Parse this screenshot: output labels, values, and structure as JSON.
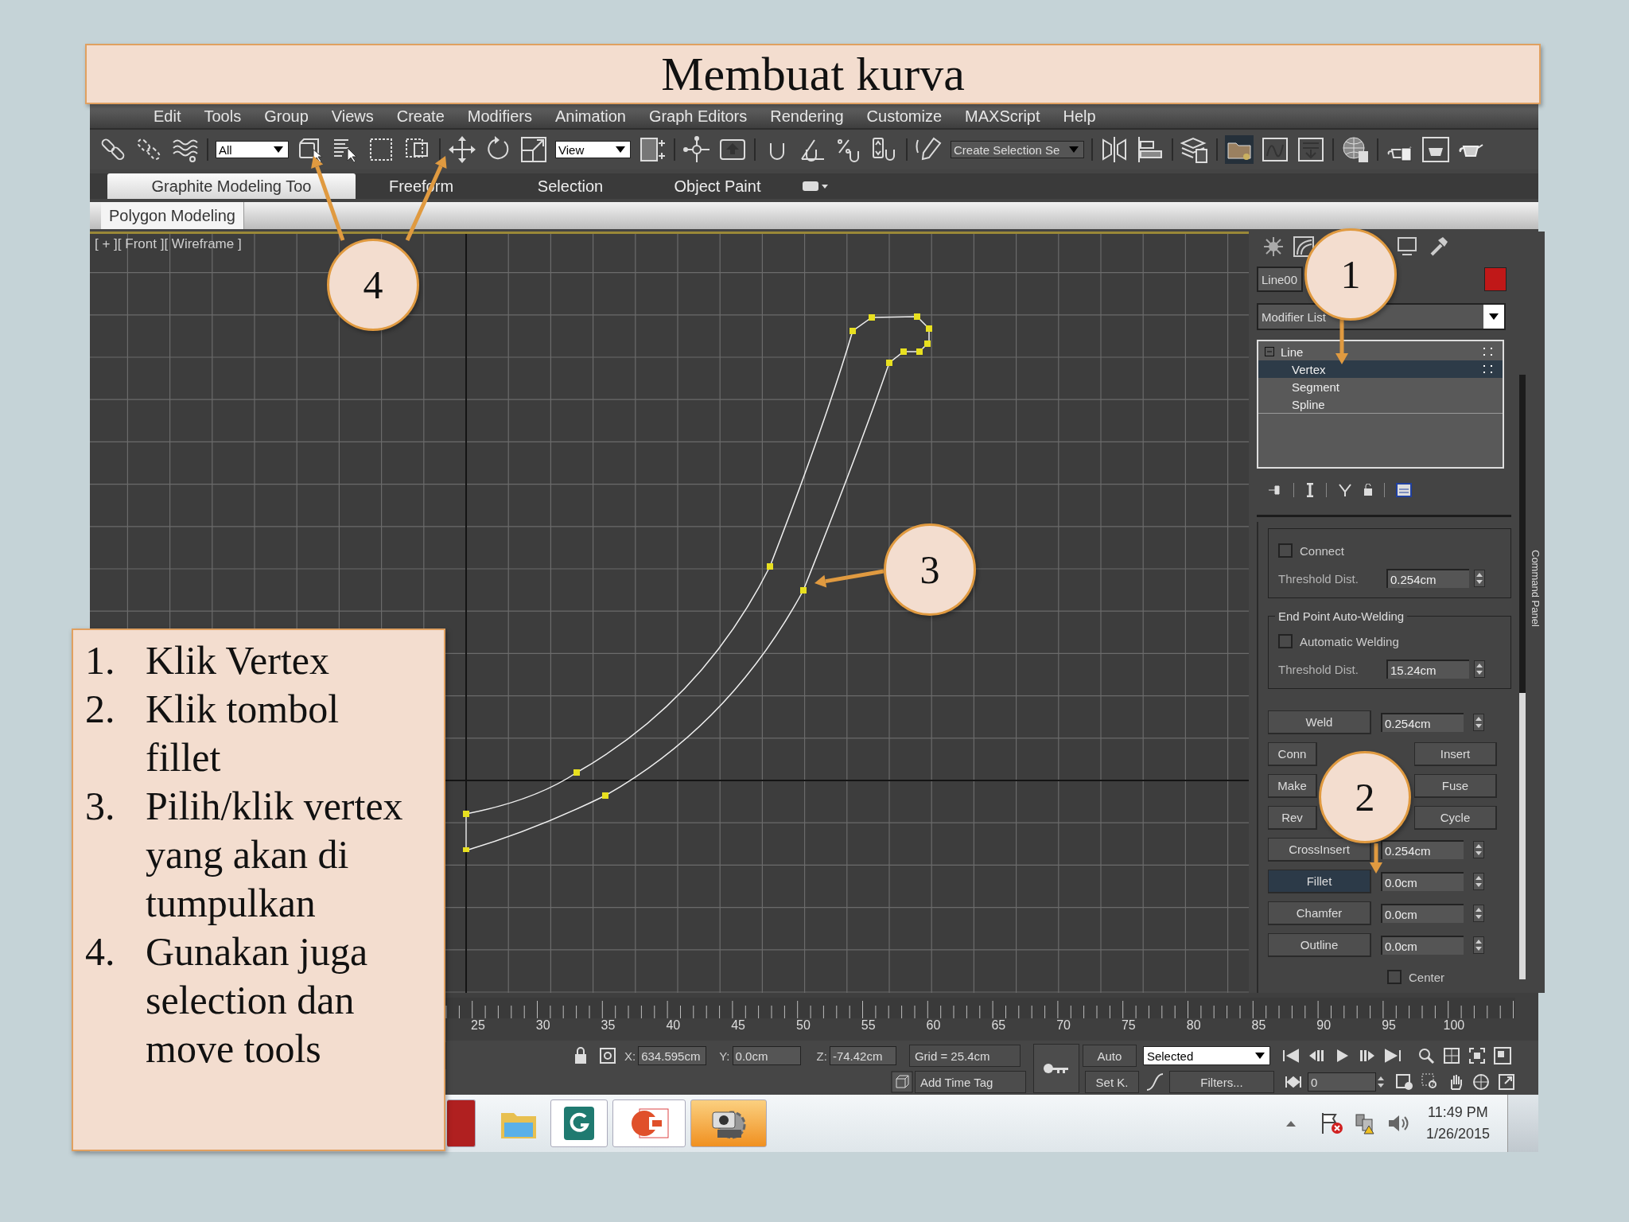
{
  "slide_title": "Membuat kurva",
  "menu": [
    "Edit",
    "Tools",
    "Group",
    "Views",
    "Create",
    "Modifiers",
    "Animation",
    "Graph Editors",
    "Rendering",
    "Customize",
    "MAXScript",
    "Help"
  ],
  "toolbar": {
    "selection_filter": "All",
    "reference_coordinate": "View",
    "named_selection": "Create Selection Se"
  },
  "ribbon": {
    "tabs": [
      {
        "label": "Graphite Modeling Too",
        "selected": true
      },
      {
        "label": "Freeform",
        "selected": false
      },
      {
        "label": "Selection",
        "selected": false
      },
      {
        "label": "Object Paint",
        "selected": false
      }
    ],
    "panel": "Polygon Modeling"
  },
  "viewport": {
    "label": "[ + ][ Front ][ Wireframe ]"
  },
  "command_panel": {
    "object_name": "Line00",
    "modifier_list": "Modifier List",
    "stack": [
      {
        "label": "Line",
        "expanded": true,
        "selected": false,
        "children": [
          {
            "label": "Vertex",
            "selected": true
          },
          {
            "label": "Segment",
            "selected": false
          },
          {
            "label": "Spline",
            "selected": false
          }
        ]
      }
    ],
    "groups": [
      {
        "items": [
          {
            "kind": "checkbox",
            "label": "Connect",
            "checked": false
          },
          {
            "kind": "spinner",
            "label": "Threshold Dist.",
            "value": "0.254cm"
          }
        ]
      },
      {
        "title": "End Point Auto-Welding",
        "items": [
          {
            "kind": "checkbox",
            "label": "Automatic Welding",
            "checked": false
          },
          {
            "kind": "spinner",
            "label": "Threshold Dist.",
            "value": "15.24cm"
          }
        ]
      }
    ],
    "rows": [
      {
        "kind": "button_spinner",
        "button": {
          "label": "Weld",
          "selected": false
        },
        "value": "0.254cm"
      },
      {
        "kind": "button_pair",
        "buttons": [
          {
            "label": "Conn",
            "selected": false
          },
          {
            "label": "Insert",
            "selected": false
          }
        ]
      },
      {
        "kind": "button_pair",
        "buttons": [
          {
            "label": "Make",
            "selected": false
          },
          {
            "label": "Fuse",
            "selected": false
          }
        ]
      },
      {
        "kind": "button_pair",
        "buttons": [
          {
            "label": "Rev",
            "selected": false
          },
          {
            "label": "Cycle",
            "selected": false
          }
        ]
      },
      {
        "kind": "button_spinner",
        "button": {
          "label": "CrossInsert",
          "selected": false
        },
        "value": "0.254cm"
      },
      {
        "kind": "button_spinner",
        "button": {
          "label": "Fillet",
          "selected": true
        },
        "value": "0.0cm"
      },
      {
        "kind": "button_spinner",
        "button": {
          "label": "Chamfer",
          "selected": false
        },
        "value": "0.0cm"
      },
      {
        "kind": "button_spinner",
        "button": {
          "label": "Outline",
          "selected": false
        },
        "value": "0.0cm"
      },
      {
        "kind": "checkbox",
        "label": "Center",
        "checked": false
      }
    ],
    "side_label": "Command Panel"
  },
  "timeline": {
    "ticks": [
      "25",
      "30",
      "35",
      "40",
      "45",
      "50",
      "55",
      "60",
      "65",
      "70",
      "75",
      "80",
      "85",
      "90",
      "95",
      "100"
    ]
  },
  "status": {
    "x_label": "X:",
    "x": "634.595cm",
    "y_label": "Y:",
    "y": "0.0cm",
    "z_label": "Z:",
    "z": "-74.42cm",
    "grid": "Grid = 25.4cm",
    "time_tag": "Add Time Tag",
    "auto_key": "Auto",
    "set_key": "Set K.",
    "key_filter": "Selected",
    "filters": "Filters...",
    "frame": "0"
  },
  "taskbar": {
    "time": "11:49 PM",
    "date": "1/26/2015"
  },
  "notes": [
    {
      "number": "1.",
      "text": "Klik Vertex"
    },
    {
      "number": "2.",
      "text": "Klik tombol fillet"
    },
    {
      "number": "3.",
      "text": "Pilih/klik vertex yang akan di tumpulkan"
    },
    {
      "number": "4.",
      "text": "Gunakan juga selection dan move tools"
    }
  ],
  "callouts": [
    {
      "label": "4"
    },
    {
      "label": "1"
    },
    {
      "label": "3"
    },
    {
      "label": "2"
    }
  ]
}
